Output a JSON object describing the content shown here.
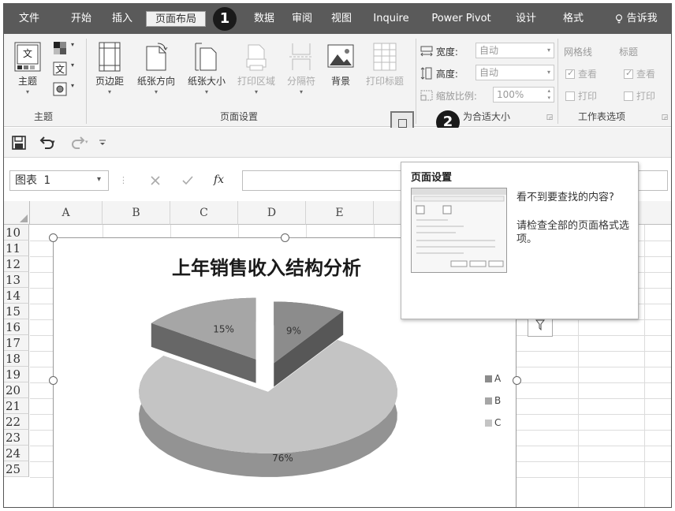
{
  "tabs": [
    "文件",
    "开始",
    "插入",
    "页面布局",
    "数据",
    "审阅",
    "视图",
    "Inquire",
    "Power Pivot",
    "设计",
    "格式"
  ],
  "active_tab": "页面布局",
  "tell_me": "告诉我",
  "callouts": {
    "one": "1",
    "two": "2"
  },
  "ribbon": {
    "themes": {
      "theme_label": "主题",
      "group_label": "主题"
    },
    "page_setup": {
      "margins": "页边距",
      "orientation": "纸张方向",
      "size": "纸张大小",
      "print_area": "打印区域",
      "breaks": "分隔符",
      "background": "背景",
      "print_titles": "打印标题",
      "group_label": "页面设置"
    },
    "scale": {
      "width_label": "宽度:",
      "width_value": "自动",
      "height_label": "高度:",
      "height_value": "自动",
      "scale_label": "缩放比例:",
      "scale_value": "100%",
      "group_label_partial": "为合适大小"
    },
    "sheet_options": {
      "gridlines": "网格线",
      "headings": "标题",
      "view": "查看",
      "print": "打印",
      "group_label": "工作表选项"
    }
  },
  "name_box": "图表 1",
  "fx": "fx",
  "columns": [
    "A",
    "B",
    "C",
    "D",
    "E"
  ],
  "rows": [
    "10",
    "11",
    "12",
    "13",
    "14",
    "15",
    "16",
    "17",
    "18",
    "19",
    "20",
    "21",
    "22",
    "23",
    "24",
    "25"
  ],
  "tooltip": {
    "title": "页面设置",
    "line1": "看不到要查找的内容?",
    "line2": "请检查全部的页面格式选项。"
  },
  "chart_data": {
    "type": "pie",
    "title": "上年销售收入结构分析",
    "categories": [
      "A",
      "B",
      "C"
    ],
    "values": [
      9,
      15,
      76
    ],
    "data_labels": [
      "9%",
      "15%",
      "76%"
    ],
    "legend": "right",
    "colors": {
      "A": "#8c8c8c",
      "B": "#a6a6a6",
      "C": "#c4c4c4"
    }
  }
}
